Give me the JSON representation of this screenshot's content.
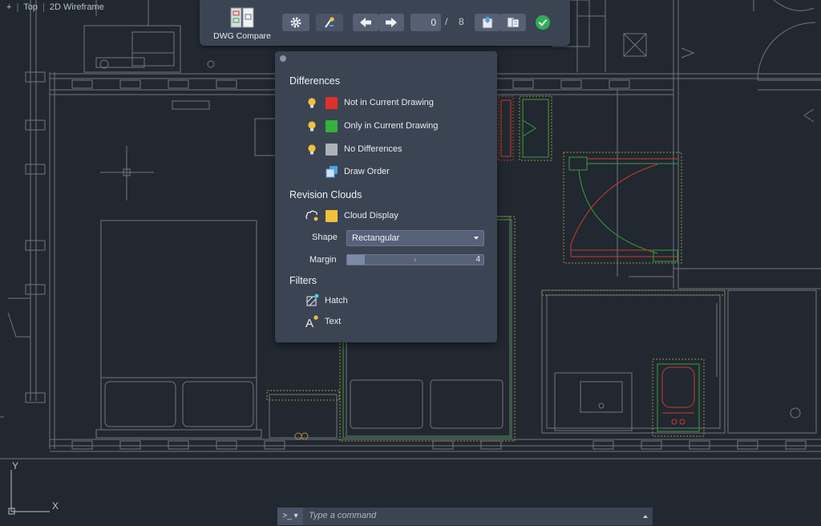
{
  "viewport": {
    "plus": "+",
    "view": "Top",
    "style": "2D Wireframe"
  },
  "toolbar": {
    "title": "DWG Compare",
    "current_index": "0",
    "separator": "/",
    "total": "8",
    "icons": [
      "compare-logo-icon",
      "settings-gear-icon",
      "highlight-pen-icon",
      "previous-arrow-icon",
      "next-arrow-icon",
      "import-drawing-icon",
      "snapshot-icon",
      "done-check-icon"
    ]
  },
  "panel": {
    "differences": {
      "title": "Differences",
      "items": [
        {
          "label": "Not in Current Drawing",
          "color": "#e0302b"
        },
        {
          "label": "Only in Current Drawing",
          "color": "#33b23a"
        },
        {
          "label": "No Differences",
          "color": "#aeb2b8"
        },
        {
          "label": "Draw Order"
        }
      ]
    },
    "revision_clouds": {
      "title": "Revision Clouds",
      "cloud_display_label": "Cloud Display",
      "cloud_color": "#f3c23a",
      "shape_label": "Shape",
      "shape_value": "Rectangular",
      "margin_label": "Margin",
      "margin_value": "4",
      "margin_fraction": 0.13
    },
    "filters": {
      "title": "Filters",
      "items": [
        {
          "label": "Hatch"
        },
        {
          "label": "Text"
        }
      ]
    }
  },
  "command_line": {
    "prompt": ">_",
    "placeholder": "Type a command"
  },
  "ucs": {
    "y": "Y",
    "x": "X"
  },
  "colors": {
    "background": "#212830",
    "panel": "#3b4453",
    "accent": "#4fa0e0"
  }
}
